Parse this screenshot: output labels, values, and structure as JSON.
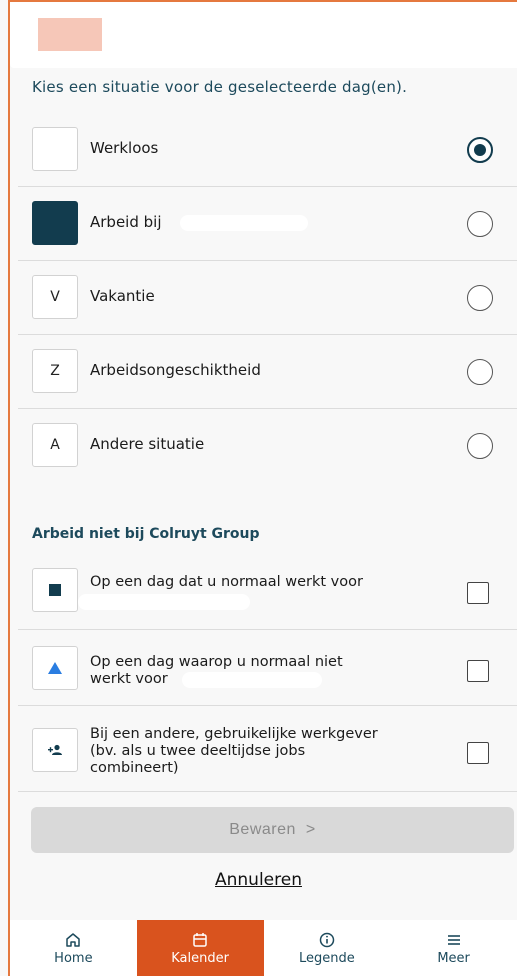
{
  "intro": "Kies een situatie voor de geselecteerde dag(en).",
  "situations": [
    {
      "code": "",
      "label": "Werkloos",
      "selected": true
    },
    {
      "code": "",
      "label": "Arbeid bij",
      "selected": false
    },
    {
      "code": "V",
      "label": "Vakantie",
      "selected": false
    },
    {
      "code": "Z",
      "label": "Arbeidsongeschiktheid",
      "selected": false
    },
    {
      "code": "A",
      "label": "Andere situatie",
      "selected": false
    }
  ],
  "section_title": "Arbeid niet bij Colruyt Group",
  "work_options": [
    {
      "label": "Op een dag dat u normaal werkt voor",
      "icon": "square-icon"
    },
    {
      "label_line1": "Op een dag waarop u normaal niet",
      "label_line2": "werkt voor",
      "icon": "triangle-icon"
    },
    {
      "label_line1": "Bij een andere, gebruikelijke werkgever",
      "label_line2": "(bv. als u twee deeltijdse jobs",
      "label_line3": "combineert)",
      "icon": "add-person-icon"
    }
  ],
  "save_button": {
    "label": "Bewaren",
    "chevron": ">"
  },
  "cancel_link": "Annuleren",
  "nav": [
    {
      "label": "Home",
      "icon": "home-icon",
      "active": false
    },
    {
      "label": "Kalender",
      "icon": "calendar-icon",
      "active": true
    },
    {
      "label": "Legende",
      "icon": "info-icon",
      "active": false
    },
    {
      "label": "Meer",
      "icon": "menu-icon",
      "active": false
    }
  ],
  "colors": {
    "accent": "#d9531e",
    "primary": "#123c4e",
    "logo": "#f6c7b8"
  }
}
